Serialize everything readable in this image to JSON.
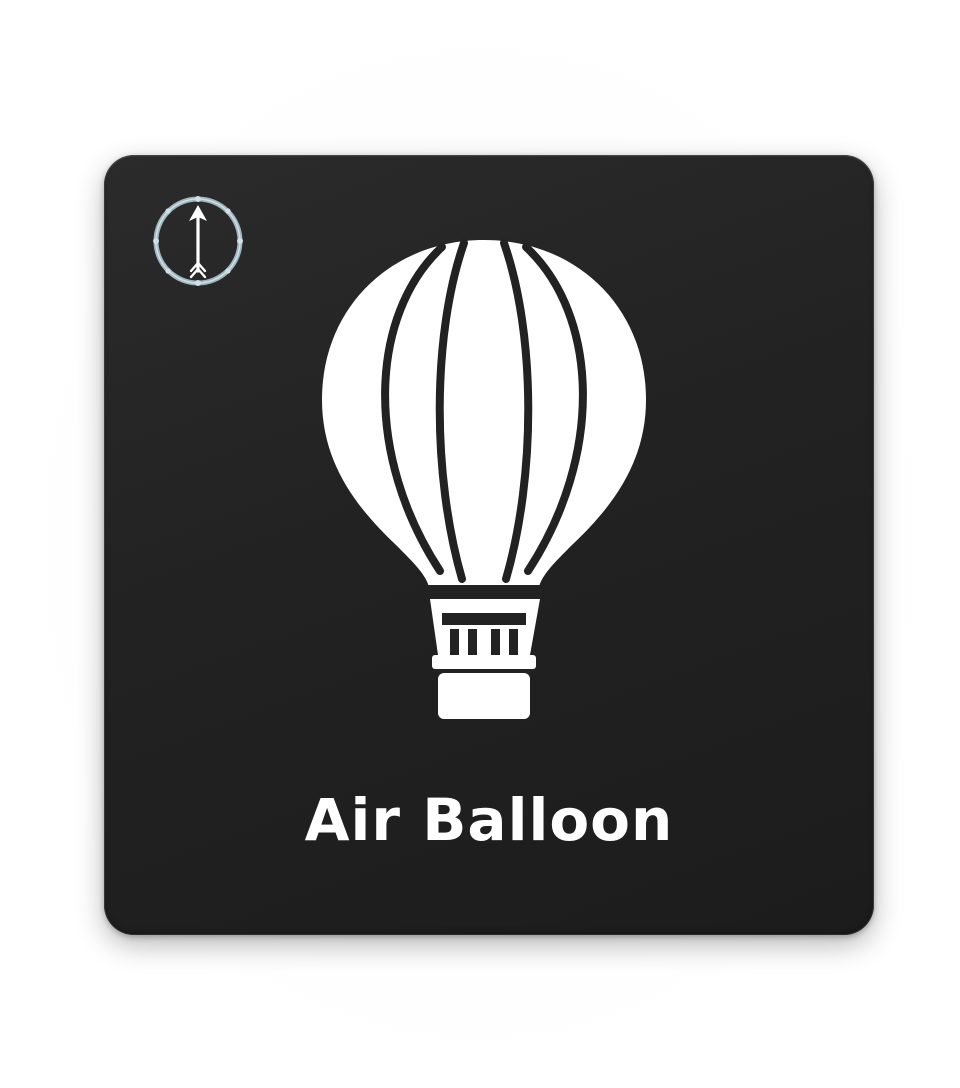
{
  "card": {
    "title": "Air Balloon",
    "background_color": "#222222",
    "foreground_color": "#ffffff"
  },
  "icons": {
    "badge": "compass-arrow-icon",
    "main": "hot-air-balloon-icon"
  }
}
